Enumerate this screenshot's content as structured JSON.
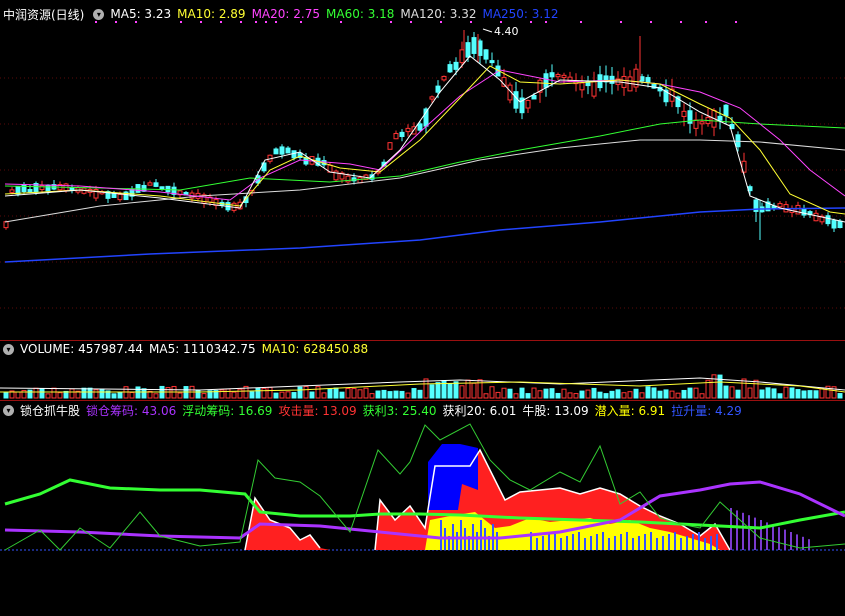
{
  "price": {
    "title": "中润资源(日线)",
    "items": [
      {
        "label": "MA5",
        "value": "3.23",
        "color": "#ffffff"
      },
      {
        "label": "MA10",
        "value": "2.89",
        "color": "#ffff33"
      },
      {
        "label": "MA20",
        "value": "2.75",
        "color": "#ff44ff"
      },
      {
        "label": "MA60",
        "value": "3.18",
        "color": "#33ff33"
      },
      {
        "label": "MA120",
        "value": "3.32",
        "color": "#dddddd"
      },
      {
        "label": "MA250",
        "value": "3.12",
        "color": "#2244ff"
      }
    ],
    "high_label": "4.40"
  },
  "volume": {
    "items": [
      {
        "label": "VOLUME",
        "value": "457987.44",
        "color": "#ffffff"
      },
      {
        "label": "MA5",
        "value": "1110342.75",
        "color": "#ffffff"
      },
      {
        "label": "MA10",
        "value": "628450.88",
        "color": "#ffff33"
      }
    ]
  },
  "indicator": {
    "title": "锁仓抓牛股",
    "items": [
      {
        "label": "锁仓筹码",
        "value": "43.06",
        "color": "#aa33ff"
      },
      {
        "label": "浮动筹码",
        "value": "16.69",
        "color": "#33ff33"
      },
      {
        "label": "攻击量",
        "value": "13.09",
        "color": "#ff3333"
      },
      {
        "label": "获利3",
        "value": "25.40",
        "color": "#33ff33"
      },
      {
        "label": "获利20",
        "value": "6.01",
        "color": "#ffffff"
      },
      {
        "label": "牛股",
        "value": "13.09",
        "color": "#ffffff"
      },
      {
        "label": "潜入量",
        "value": "6.91",
        "color": "#ffff00"
      },
      {
        "label": "拉升量",
        "value": "4.29",
        "color": "#3355ff"
      }
    ]
  }
}
